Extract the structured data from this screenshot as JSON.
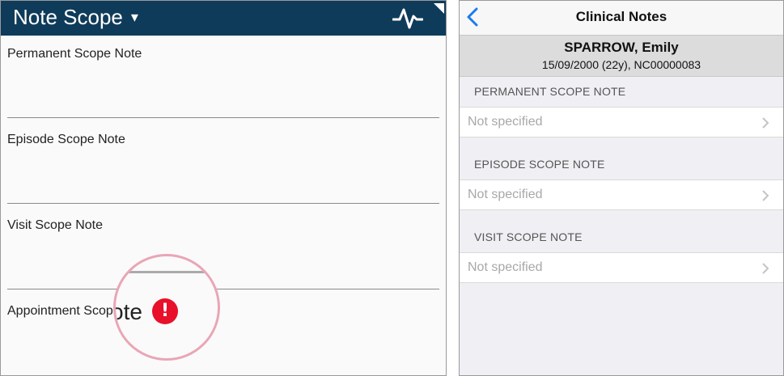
{
  "left_panel": {
    "title": "Note Scope",
    "caret": "▾",
    "header_color": "#0f3b5a",
    "header_icon": "pulse-icon",
    "fields": [
      {
        "label": "Permanent Scope Note"
      },
      {
        "label": "Episode Scope Note"
      },
      {
        "label": "Visit Scope Note"
      },
      {
        "label": "Appointment Scope Note"
      }
    ],
    "zoom_callout": {
      "text": "ote",
      "icon": "error-icon",
      "icon_glyph": "!",
      "icon_color": "#e8102a",
      "ring_color": "#e9a6b5"
    }
  },
  "right_panel": {
    "nav": {
      "back_icon": "chevron-left-icon",
      "title": "Clinical Notes",
      "accent": "#1a7cf0"
    },
    "patient": {
      "name": "SPARROW, Emily",
      "details": "15/09/2000 (22y), NC00000083"
    },
    "sections": [
      {
        "header": "PERMANENT SCOPE NOTE",
        "value": "Not specified"
      },
      {
        "header": "EPISODE SCOPE NOTE",
        "value": "Not specified"
      },
      {
        "header": "VISIT SCOPE NOTE",
        "value": "Not specified"
      }
    ]
  }
}
